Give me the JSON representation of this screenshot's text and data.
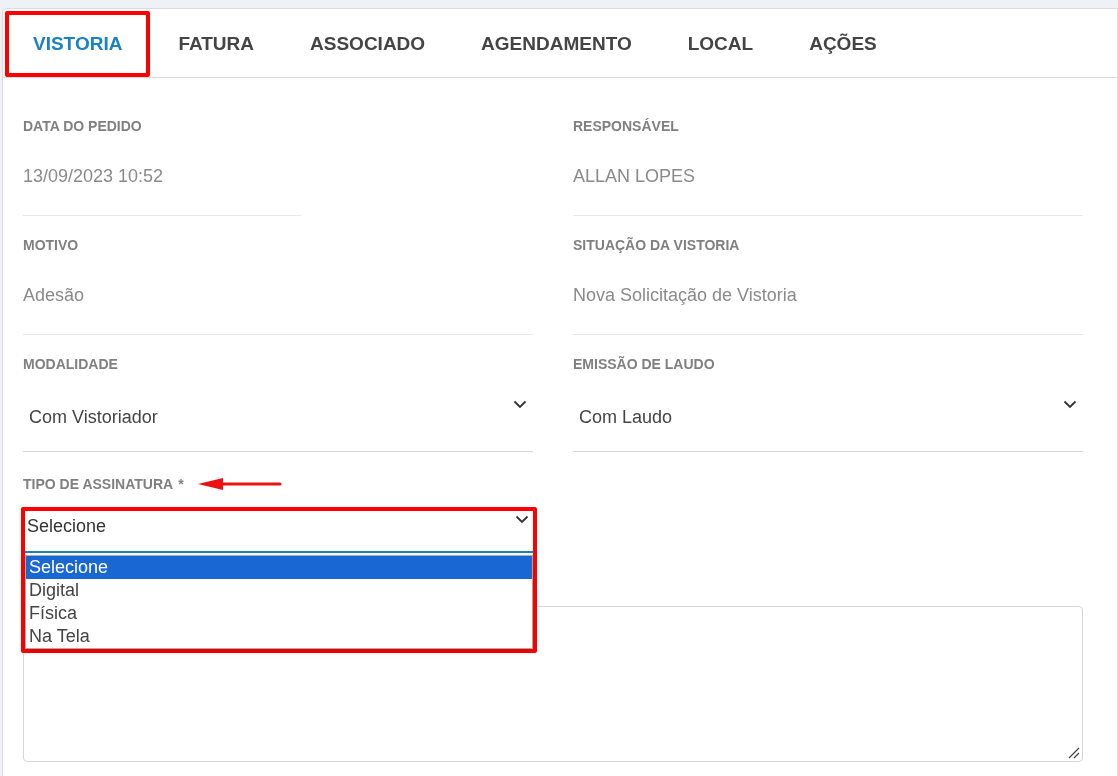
{
  "tabs": [
    {
      "label": "VISTORIA",
      "selected": true,
      "highlighted": true
    },
    {
      "label": "FATURA",
      "selected": false,
      "highlighted": false
    },
    {
      "label": "ASSOCIADO",
      "selected": false,
      "highlighted": false
    },
    {
      "label": "AGENDAMENTO",
      "selected": false,
      "highlighted": false
    },
    {
      "label": "LOCAL",
      "selected": false,
      "highlighted": false
    },
    {
      "label": "AÇÕES",
      "selected": false,
      "highlighted": false
    }
  ],
  "fields": [
    {
      "kind": "text",
      "label": "DATA DO PEDIDO",
      "value": "13/09/2023 10:52",
      "short": true
    },
    {
      "kind": "text",
      "label": "RESPONSÁVEL",
      "value": "ALLAN LOPES",
      "short": false
    },
    {
      "kind": "text",
      "label": "MOTIVO",
      "value": "Adesão",
      "short": false
    },
    {
      "kind": "text",
      "label": "SITUAÇÃO DA VISTORIA",
      "value": "Nova Solicitação de Vistoria",
      "short": false
    },
    {
      "kind": "select",
      "label": "MODALIDADE",
      "value": "Com Vistoriador",
      "short": false
    },
    {
      "kind": "select",
      "label": "EMISSÃO DE LAUDO",
      "value": "Com Laudo",
      "short": false
    }
  ],
  "signature": {
    "label": "TIPO DE ASSINATURA",
    "required_mark": "*",
    "arrow": true,
    "highlighted": true,
    "value": "Selecione",
    "expanded": true,
    "options": [
      {
        "label": "Selecione",
        "selected": true
      },
      {
        "label": "Digital",
        "selected": false
      },
      {
        "label": "Física",
        "selected": false
      },
      {
        "label": "Na Tela",
        "selected": false
      }
    ]
  }
}
